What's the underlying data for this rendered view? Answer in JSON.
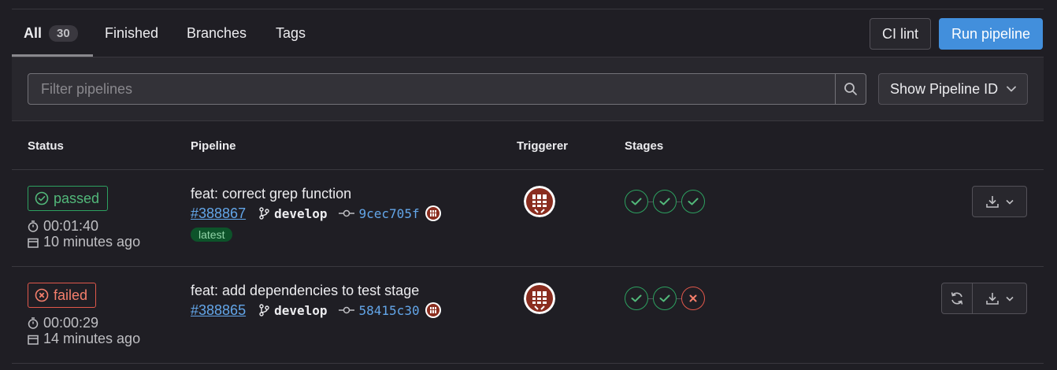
{
  "tabs": [
    {
      "label": "All",
      "count": "30"
    },
    {
      "label": "Finished"
    },
    {
      "label": "Branches"
    },
    {
      "label": "Tags"
    }
  ],
  "buttons": {
    "ci_lint": "CI lint",
    "run_pipeline": "Run pipeline"
  },
  "filter": {
    "placeholder": "Filter pipelines",
    "dropdown_label": "Show Pipeline ID"
  },
  "columns": {
    "status": "Status",
    "pipeline": "Pipeline",
    "triggerer": "Triggerer",
    "stages": "Stages"
  },
  "pipelines": [
    {
      "status": "passed",
      "duration": "00:01:40",
      "finished": "10 minutes ago",
      "title": "feat: correct grep function",
      "id": "#388867",
      "branch": "develop",
      "sha": "9cec705f",
      "badge": "latest",
      "stages": [
        "success",
        "success",
        "success"
      ]
    },
    {
      "status": "failed",
      "duration": "00:00:29",
      "finished": "14 minutes ago",
      "title": "feat: add dependencies to test stage",
      "id": "#388865",
      "branch": "develop",
      "sha": "58415c30",
      "stages": [
        "success",
        "success",
        "failed"
      ]
    }
  ],
  "colors": {
    "accent": "#428fdc",
    "success": "#2da160",
    "danger": "#e1584b",
    "avatar": "#8a2d1f"
  },
  "icons": [
    "search-icon",
    "chevron-down-icon",
    "check-circle-icon",
    "x-circle-icon",
    "timer-icon",
    "calendar-icon",
    "branch-icon",
    "commit-icon",
    "download-icon",
    "retry-icon",
    "avatar"
  ]
}
